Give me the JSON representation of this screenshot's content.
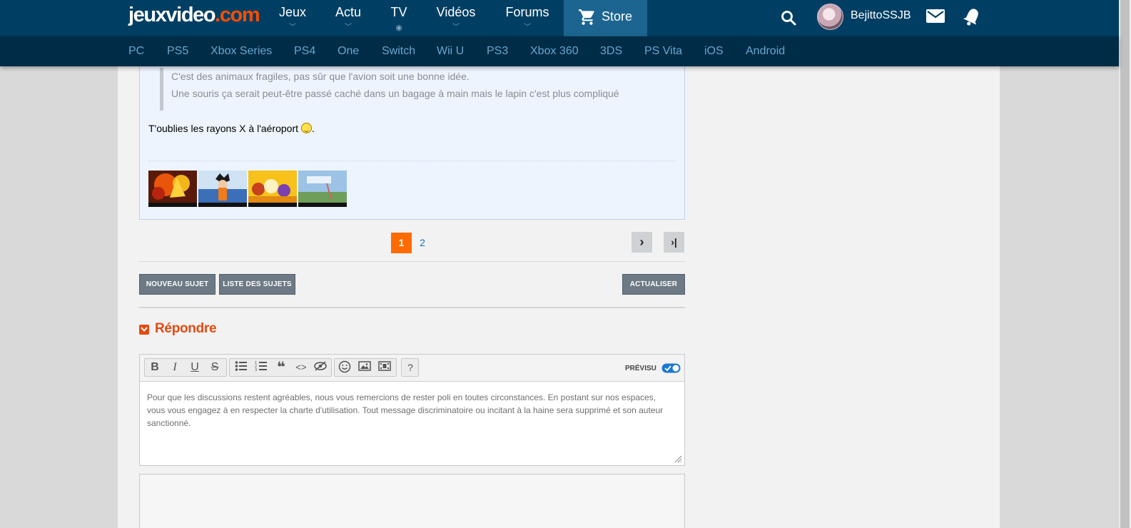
{
  "header": {
    "logo_main": "jeuxvideo",
    "logo_dot": ".com",
    "nav": [
      {
        "label": "Jeux"
      },
      {
        "label": "Actu"
      },
      {
        "label": "TV"
      },
      {
        "label": "Vidéos"
      },
      {
        "label": "Forums"
      }
    ],
    "store_label": "Store",
    "username": "BejittoSSJB"
  },
  "platforms": [
    "PC",
    "PS5",
    "Xbox Series",
    "PS4",
    "One",
    "Switch",
    "Wii U",
    "PS3",
    "Xbox 360",
    "3DS",
    "PS Vita",
    "iOS",
    "Android"
  ],
  "post": {
    "quote_lines": [
      "C'est des animaux fragiles, pas sûr que l'avion soit une bonne idée.",
      "Une souris ça serait peut-être passé caché dans un bagage à main mais le lapin c'est plus compliqué"
    ],
    "reply_text": "T'oublies les rayons X à l'aéroport ",
    "reply_end": "."
  },
  "pagination": {
    "current": "1",
    "next_page": "2",
    "next_symbol": "›",
    "last_symbol": "›|"
  },
  "actions": {
    "new_topic": "NOUVEAU SUJET",
    "topic_list": "LISTE DES SUJETS",
    "refresh": "ACTUALISER"
  },
  "reply": {
    "title": "Répondre",
    "preview_label": "PRÉVISU",
    "placeholder": "Pour que les discussions restent agréables, nous vous remercions de rester poli en toutes circonstances. En postant sur nos espaces, vous vous engagez à en respecter la charte d'utilisation. Tout message discriminatoire ou incitant à la haine sera supprimé et son auteur sanctionné.",
    "toolbar": {
      "bold": "B",
      "italic": "I",
      "underline": "U",
      "strike": "S",
      "quote": "❝",
      "code": "<>",
      "help": "?"
    }
  },
  "colors": {
    "header_bg": "#003f63",
    "platform_bg": "#002c47",
    "store_bg": "#1c6590",
    "accent_orange": "#ff6b00",
    "reply_red": "#e34b10"
  }
}
